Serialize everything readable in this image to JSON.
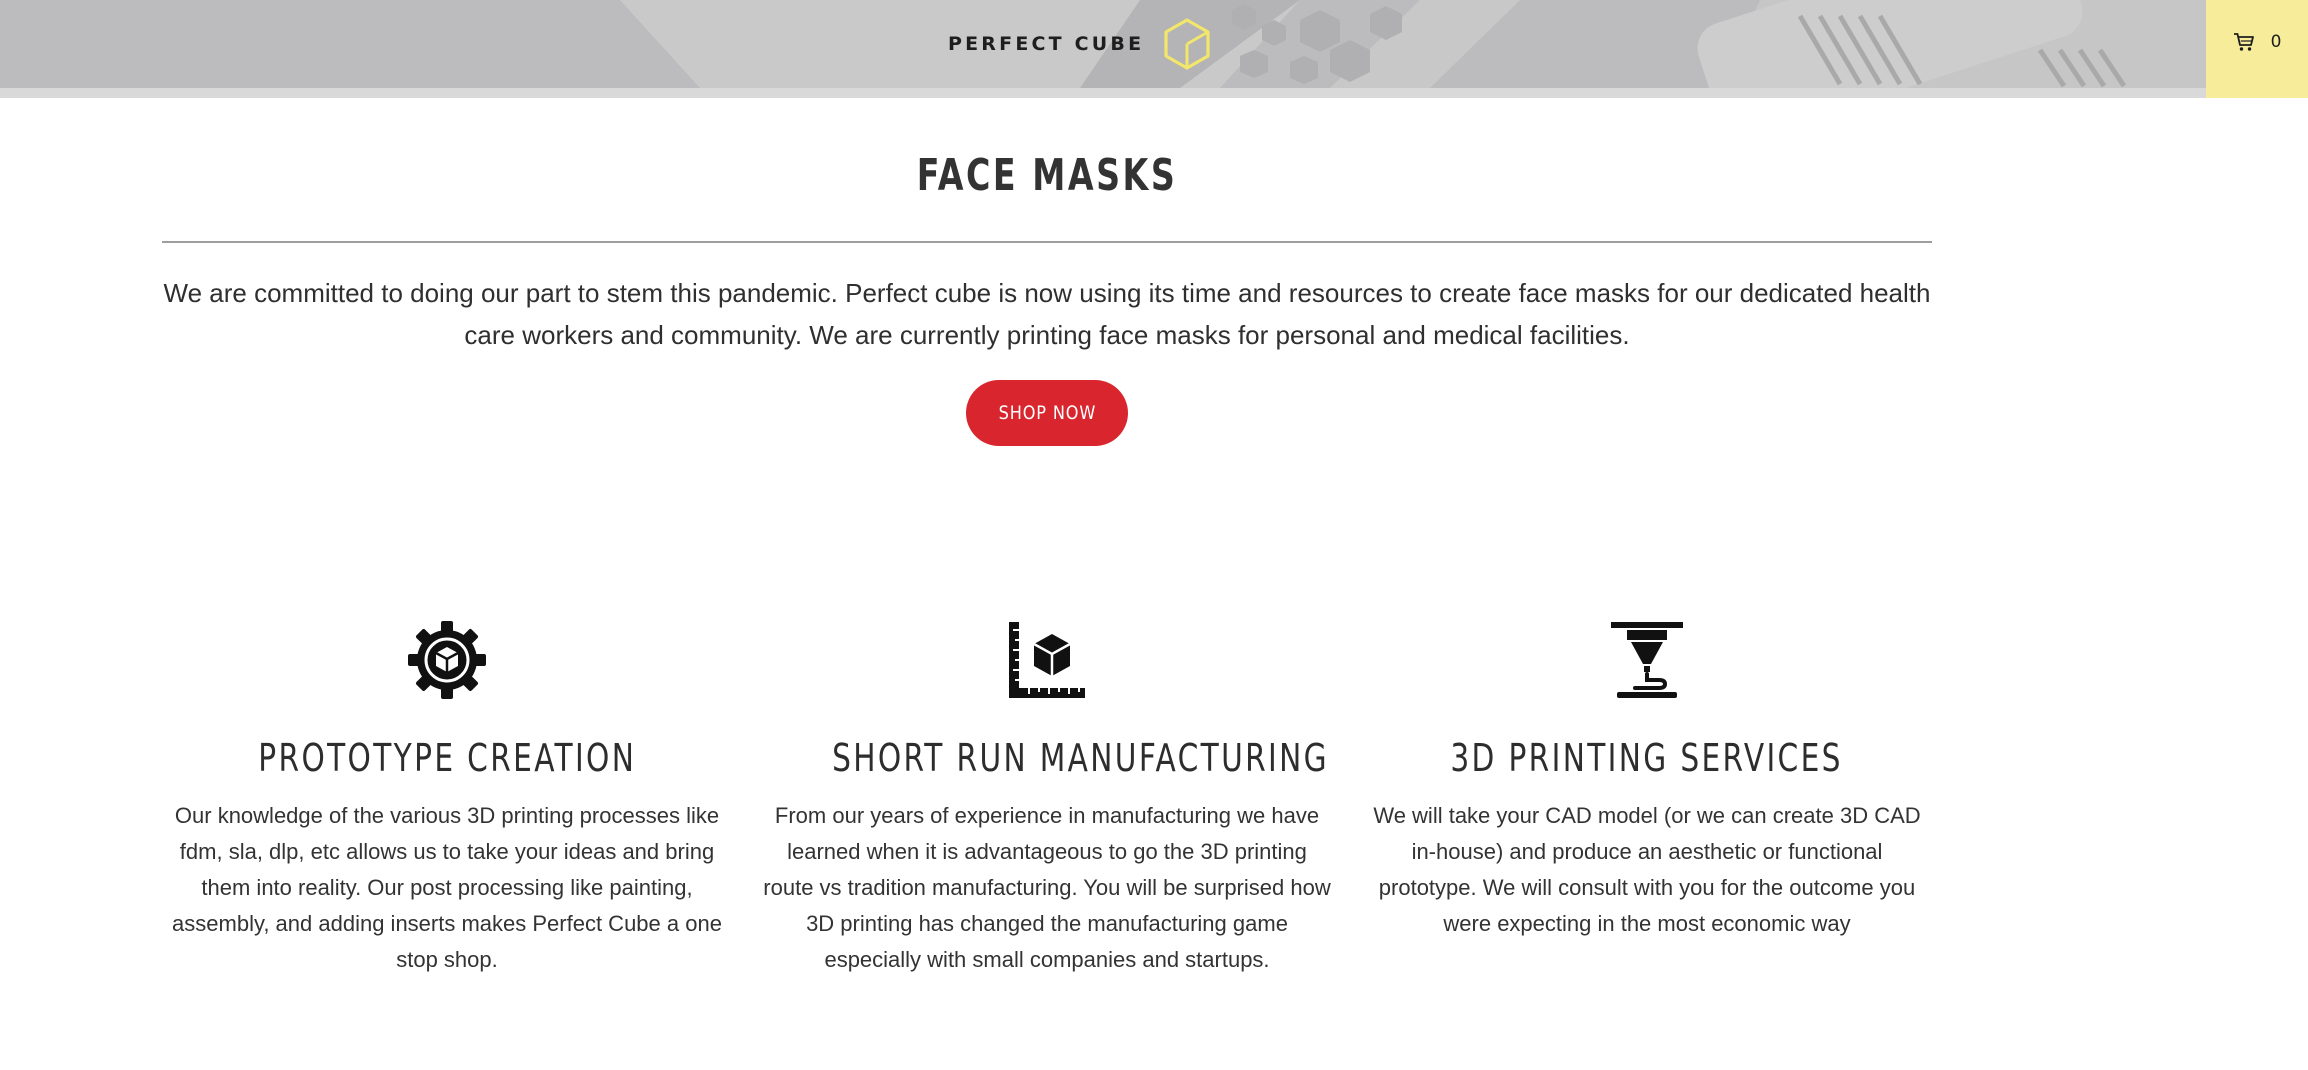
{
  "header": {
    "logo_text": "PERFECT CUBE",
    "cart_count": "0",
    "colors": {
      "bar": "#c4c4c4",
      "cart_bg": "#f7ec9a",
      "logo_mark": "#f2e66b"
    }
  },
  "hero": {
    "title": "FACE MASKS",
    "intro": "We are committed to doing our part to stem this pandemic. Perfect cube is now using its time and resources to create face masks for our dedicated health care workers and community. We are currently printing face masks  for personal and medical facilities.",
    "button_label": "SHOP NOW",
    "button_color": "#d9262e"
  },
  "features": [
    {
      "icon": "gear-cube-icon",
      "title": "PROTOTYPE CREATION",
      "text": "Our knowledge of the various 3D printing processes like fdm, sla, dlp, etc allows us to take your ideas and bring them into reality. Our post processing like painting, assembly, and adding inserts makes Perfect Cube a one stop shop."
    },
    {
      "icon": "ruler-cube-icon",
      "title": "SHORT RUN MANUFACTURING",
      "text": "From our years of experience in manufacturing we have learned when it is advantageous to go the 3D printing route vs tradition manufacturing. You will be surprised how 3D printing has changed the manufacturing game especially with small companies and startups."
    },
    {
      "icon": "3d-printer-nozzle-icon",
      "title": "3D PRINTING SERVICES",
      "text": "We will take your CAD model (or we can create 3D CAD in-house) and produce an aesthetic or functional prototype. We will consult with you for the outcome you were expecting in the most economic way"
    }
  ]
}
